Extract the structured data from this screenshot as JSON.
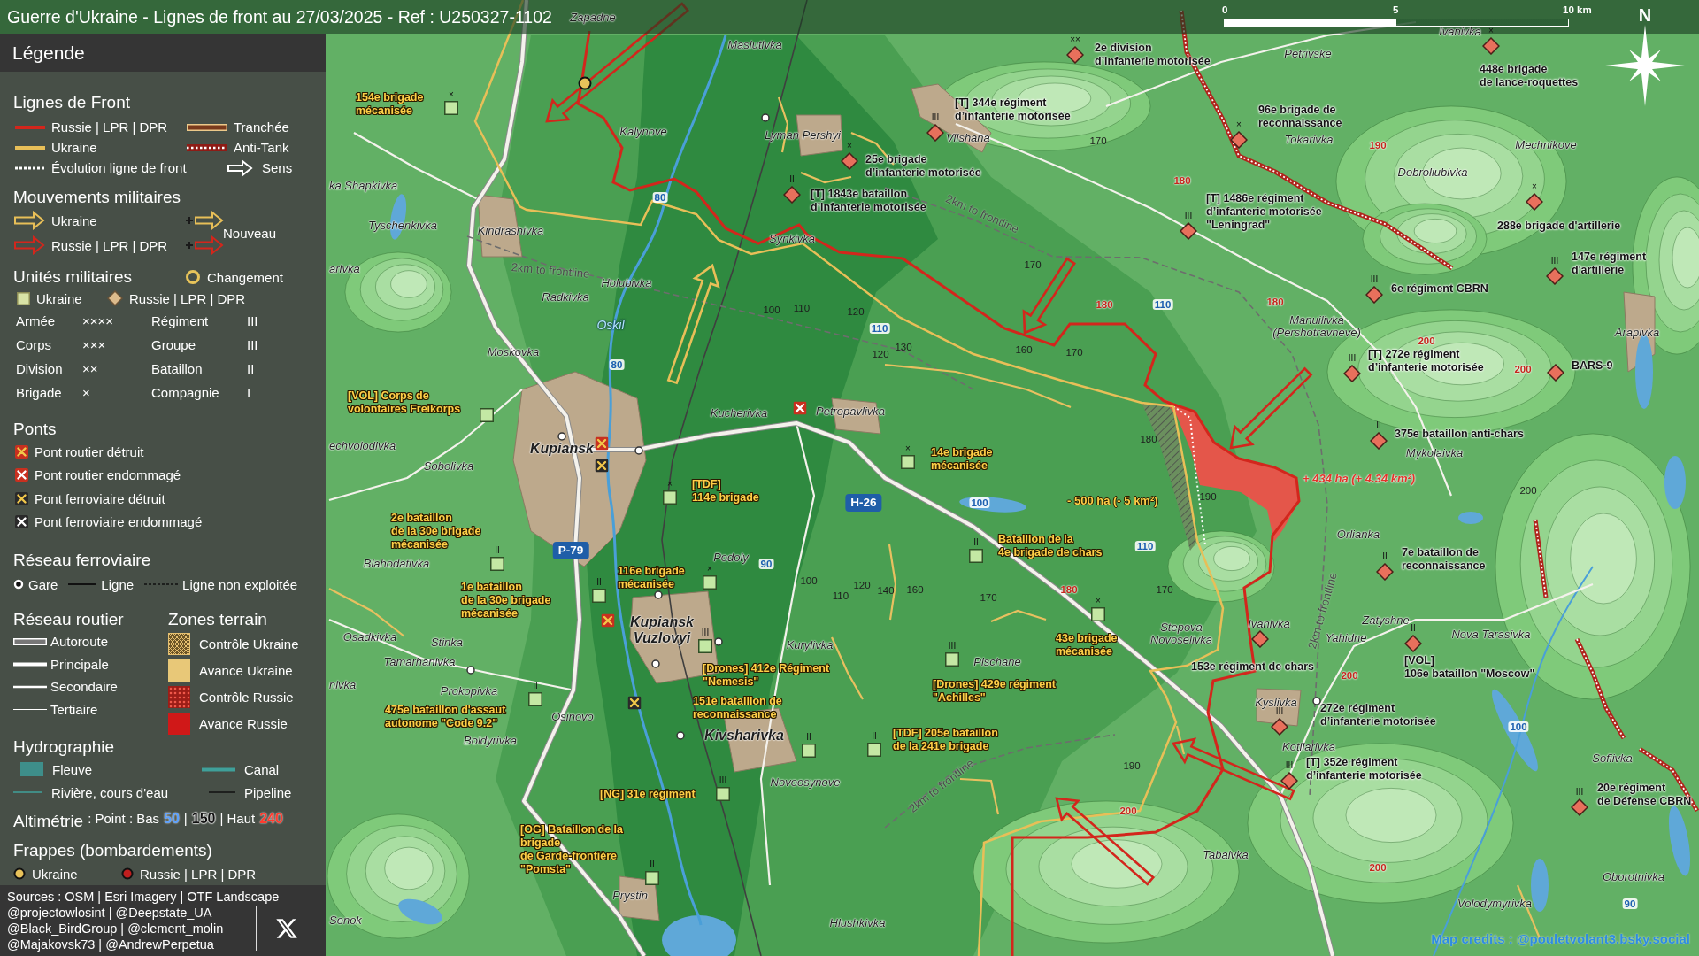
{
  "title": "Guerre d'Ukraine - Lignes de front au 27/03/2025 - Ref : U250327-1102",
  "scale": {
    "ticks": [
      "0",
      "5",
      "10 km"
    ]
  },
  "compass": "N",
  "legend": {
    "title": "Légende",
    "front_lines": {
      "heading": "Lignes de Front",
      "items": [
        {
          "label": "Russie | LPR | DPR",
          "kind": "russia-line"
        },
        {
          "label": "Tranchée",
          "kind": "trench"
        },
        {
          "label": "Ukraine",
          "kind": "ukraine-line"
        },
        {
          "label": "Anti-Tank",
          "kind": "antitank"
        },
        {
          "label": "Évolution ligne de front",
          "kind": "evolution"
        },
        {
          "label": "Sens",
          "kind": "direction"
        }
      ]
    },
    "movements": {
      "heading": "Mouvements militaires",
      "items": [
        {
          "label": "Ukraine",
          "kind": "ukraine"
        },
        {
          "label": "Russie | LPR | DPR",
          "kind": "russia"
        }
      ],
      "new_label": "Nouveau"
    },
    "units": {
      "heading": "Unités militaires",
      "change_label": "Changement",
      "markers": [
        {
          "label": "Ukraine",
          "kind": "ukraine"
        },
        {
          "label": "Russie | LPR | DPR",
          "kind": "russia"
        }
      ],
      "echelons": [
        {
          "label": "Armée",
          "symbol": "××××"
        },
        {
          "label": "Régiment",
          "symbol": "III"
        },
        {
          "label": "Corps",
          "symbol": "×××"
        },
        {
          "label": "Groupe",
          "symbol": "III"
        },
        {
          "label": "Division",
          "symbol": "××"
        },
        {
          "label": "Bataillon",
          "symbol": "II"
        },
        {
          "label": "Brigade",
          "symbol": "×"
        },
        {
          "label": "Compagnie",
          "symbol": "I"
        }
      ]
    },
    "bridges": {
      "heading": "Ponts",
      "items": [
        {
          "label": "Pont routier détruit",
          "kind": "road-destroyed"
        },
        {
          "label": "Pont routier endommagé",
          "kind": "road-damaged"
        },
        {
          "label": "Pont ferroviaire détruit",
          "kind": "rail-destroyed"
        },
        {
          "label": "Pont ferroviaire endommagé",
          "kind": "rail-damaged"
        }
      ]
    },
    "railway": {
      "heading": "Réseau ferroviaire",
      "items": [
        {
          "label": "Gare",
          "kind": "station"
        },
        {
          "label": "Ligne",
          "kind": "line"
        },
        {
          "label": "Ligne non exploitée",
          "kind": "unused"
        }
      ]
    },
    "roads": {
      "heading": "Réseau routier",
      "items": [
        {
          "label": "Autoroute",
          "kind": "motorway"
        },
        {
          "label": "Principale",
          "kind": "primary"
        },
        {
          "label": "Secondaire",
          "kind": "secondary"
        },
        {
          "label": "Tertiaire",
          "kind": "tertiary"
        }
      ]
    },
    "zones": {
      "heading": "Zones terrain",
      "items": [
        {
          "label": "Contrôle Ukraine",
          "kind": "ukraine-control"
        },
        {
          "label": "Avance Ukraine",
          "kind": "ukraine-advance"
        },
        {
          "label": "Contrôle Russie",
          "kind": "russia-control"
        },
        {
          "label": "Avance Russie",
          "kind": "russia-advance"
        }
      ]
    },
    "hydrography": {
      "heading": "Hydrographie",
      "items": [
        {
          "label": "Fleuve",
          "kind": "river"
        },
        {
          "label": "Canal",
          "kind": "canal"
        },
        {
          "label": "Rivière, cours d'eau",
          "kind": "stream"
        },
        {
          "label": "Pipeline",
          "kind": "pipeline"
        }
      ]
    },
    "altimetry": {
      "heading": "Altimétrie",
      "parts": [
        {
          "text": ": Point : Bas",
          "kind": "plain"
        },
        {
          "text": "50",
          "kind": "low"
        },
        {
          "text": "|",
          "kind": "plain"
        },
        {
          "text": "150",
          "kind": "mid"
        },
        {
          "text": "| Haut",
          "kind": "plain"
        },
        {
          "text": "240",
          "kind": "high"
        }
      ]
    },
    "strikes": {
      "heading": "Frappes (bombardements)",
      "items": [
        {
          "label": "Ukraine",
          "kind": "ukraine"
        },
        {
          "label": "Russie | LPR | DPR",
          "kind": "russia"
        }
      ]
    },
    "sources": [
      "Sources : OSM | Esri Imagery | OTF Landscape",
      "@projectowlosint | @Deepstate_UA",
      "@Black_BirdGroup | @clement_molin",
      "@Majakovsk73 | @AndrewPerpetua"
    ]
  },
  "map": {
    "places": [
      {
        "name": "Zapadne",
        "kind": "village"
      },
      {
        "name": "Ivanivka",
        "kind": "village"
      },
      {
        "name": "Masiutivka",
        "kind": "village"
      },
      {
        "name": "Petrivske",
        "kind": "village"
      },
      {
        "name": "Kalynove",
        "kind": "village"
      },
      {
        "name": "Lyman Pershyi",
        "kind": "village"
      },
      {
        "name": "Vilshana",
        "kind": "village"
      },
      {
        "name": "Tokarivka",
        "kind": "village"
      },
      {
        "name": "Mechnikove",
        "kind": "village"
      },
      {
        "name": "Dobroliubivka",
        "kind": "village"
      },
      {
        "name": "ka Shapkivka",
        "kind": "village"
      },
      {
        "name": "Tyschenkivka",
        "kind": "village"
      },
      {
        "name": "Kindrashivka",
        "kind": "village"
      },
      {
        "name": "Synkivka",
        "kind": "village"
      },
      {
        "name": "arivka",
        "kind": "village"
      },
      {
        "name": "Holubivka",
        "kind": "village"
      },
      {
        "name": "Radkivka",
        "kind": "village"
      },
      {
        "name": "Oskil",
        "kind": "river"
      },
      {
        "name": "Manuilivka\n(Pershotravneve)",
        "kind": "village"
      },
      {
        "name": "Arapivka",
        "kind": "village"
      },
      {
        "name": "Moskovka",
        "kind": "village"
      },
      {
        "name": "Kucherivka",
        "kind": "village"
      },
      {
        "name": "Petropavlivka",
        "kind": "village"
      },
      {
        "name": "echvolodivka",
        "kind": "village"
      },
      {
        "name": "Kupiansk",
        "kind": "town"
      },
      {
        "name": "Mykolaivka",
        "kind": "village"
      },
      {
        "name": "Sobolivka",
        "kind": "village"
      },
      {
        "name": "Orlianka",
        "kind": "village"
      },
      {
        "name": "Blahodativka",
        "kind": "village"
      },
      {
        "name": "Podoly",
        "kind": "village"
      },
      {
        "name": "Osadkivka",
        "kind": "village"
      },
      {
        "name": "Stinka",
        "kind": "village"
      },
      {
        "name": "Kupiansk\nVuzlovyi",
        "kind": "town"
      },
      {
        "name": "Kurylivka",
        "kind": "village"
      },
      {
        "name": "Stepova\nNovoselivka",
        "kind": "village"
      },
      {
        "name": "Ivanivka",
        "kind": "village"
      },
      {
        "name": "Yahidne",
        "kind": "village"
      },
      {
        "name": "Zatyshne",
        "kind": "village"
      },
      {
        "name": "Nova Tarasivka",
        "kind": "village"
      },
      {
        "name": "Tamarhanivka",
        "kind": "village"
      },
      {
        "name": "Pischane",
        "kind": "village"
      },
      {
        "name": "nivka",
        "kind": "village"
      },
      {
        "name": "Prokopivka",
        "kind": "village"
      },
      {
        "name": "Kyslivka",
        "kind": "village"
      },
      {
        "name": "Osinovo",
        "kind": "village"
      },
      {
        "name": "Boldyrivka",
        "kind": "village"
      },
      {
        "name": "Kivsharivka",
        "kind": "town"
      },
      {
        "name": "Kotliarivka",
        "kind": "village"
      },
      {
        "name": "Sofiivka",
        "kind": "village"
      },
      {
        "name": "Novoosynove",
        "kind": "village"
      },
      {
        "name": "Tabaivka",
        "kind": "village"
      },
      {
        "name": "Oborotnivka",
        "kind": "village"
      },
      {
        "name": "Prystin",
        "kind": "village"
      },
      {
        "name": "Volodymyrivka",
        "kind": "village"
      },
      {
        "name": "Senok",
        "kind": "village"
      },
      {
        "name": "Hlushkivka",
        "kind": "village"
      }
    ],
    "units": [
      {
        "label": "2e division\nd’infanterie motorisée",
        "kind": "russia",
        "echelon": "××"
      },
      {
        "label": "[T] 344e régiment\nd’infanterie motorisée",
        "kind": "russia",
        "echelon": "III"
      },
      {
        "label": "448e brigade\nde lance-roquettes",
        "kind": "russia",
        "echelon": "×"
      },
      {
        "label": "96e brigade de\nreconnaissance",
        "kind": "russia",
        "echelon": "×"
      },
      {
        "label": "25e brigade\nd’infanterie motorisée",
        "kind": "russia",
        "echelon": "×"
      },
      {
        "label": "[T] 1843e bataillon\nd’infanterie motorisée",
        "kind": "russia",
        "echelon": "II"
      },
      {
        "label": "[T] 1486e régiment\nd’infanterie motorisée\n\"Leningrad\"",
        "kind": "russia",
        "echelon": "III"
      },
      {
        "label": "288e brigade d'artillerie",
        "kind": "russia",
        "echelon": "×"
      },
      {
        "label": "147e régiment\nd'artillerie",
        "kind": "russia",
        "echelon": "III"
      },
      {
        "label": "6e régiment CBRN",
        "kind": "russia",
        "echelon": "III"
      },
      {
        "label": "[T] 272e régiment\nd’infanterie motorisée",
        "kind": "russia",
        "echelon": "III"
      },
      {
        "label": "BARS-9",
        "kind": "russia"
      },
      {
        "label": "375e bataillon anti-chars",
        "kind": "russia",
        "echelon": "II"
      },
      {
        "label": "7e bataillon de\nreconnaissance",
        "kind": "russia",
        "echelon": "II"
      },
      {
        "label": "153e régiment de chars",
        "kind": "russia"
      },
      {
        "label": "[VOL]\n106e bataillon \"Moscow\"",
        "kind": "russia",
        "echelon": "II"
      },
      {
        "label": "272e régiment\nd’infanterie motorisée",
        "kind": "russia",
        "echelon": "III"
      },
      {
        "label": "[T] 352e régiment\nd’infanterie motorisée",
        "kind": "russia",
        "echelon": "III"
      },
      {
        "label": "20e régiment\nde Défense CBRN",
        "kind": "russia",
        "echelon": "III"
      },
      {
        "label": "154e brigade\nmécanisée",
        "kind": "ukraine",
        "echelon": "×"
      },
      {
        "label": "[VOL] Corps de\nvolontaires Freikorps",
        "kind": "ukraine"
      },
      {
        "label": "[TDF]\n114e brigade",
        "kind": "ukraine",
        "echelon": "×"
      },
      {
        "label": "14e brigade\nmécanisée",
        "kind": "ukraine",
        "echelon": "×"
      },
      {
        "label": "2e bataillon\nde la 30e brigade\nmécanisée",
        "kind": "ukraine",
        "echelon": "II"
      },
      {
        "label": "1e bataillon\nde la 30e brigade\nmécanisée",
        "kind": "ukraine",
        "echelon": "II"
      },
      {
        "label": "116e brigade\nmécanisée",
        "kind": "ukraine",
        "echelon": "×"
      },
      {
        "label": "Bataillon de la\n4e brigade de chars",
        "kind": "ukraine",
        "echelon": "II"
      },
      {
        "label": "43e brigade\nmécanisée",
        "kind": "ukraine",
        "echelon": "×"
      },
      {
        "label": "[Drones] 412e Régiment\n\"Nemesis\"",
        "kind": "ukraine",
        "echelon": "III"
      },
      {
        "label": "[Drones] 429e régiment\n\"Achilles\"",
        "kind": "ukraine",
        "echelon": "III"
      },
      {
        "label": "475e bataillon d'assaut\nautonome \"Code 9.2\"",
        "kind": "ukraine",
        "echelon": "II"
      },
      {
        "label": "151e bataillon de\nreconnaissance",
        "kind": "ukraine",
        "echelon": "II"
      },
      {
        "label": "[TDF] 205e bataillon\nde la 241e brigade",
        "kind": "ukraine",
        "echelon": "II"
      },
      {
        "label": "[NG] 31e régiment",
        "kind": "ukraine",
        "echelon": "III"
      },
      {
        "label": "[OG] Bataillon de la\nbrigade\nde Garde-frontière\n\"Pomsta\"",
        "kind": "ukraine",
        "echelon": "II"
      }
    ],
    "elevation_points": [
      {
        "value": "170",
        "kind": "mid"
      },
      {
        "value": "190",
        "kind": "high"
      },
      {
        "value": "180",
        "kind": "high"
      },
      {
        "value": "80",
        "kind": "low"
      },
      {
        "value": "170",
        "kind": "mid"
      },
      {
        "value": "100",
        "kind": "mid"
      },
      {
        "value": "110",
        "kind": "mid"
      },
      {
        "value": "120",
        "kind": "mid"
      },
      {
        "value": "180",
        "kind": "high"
      },
      {
        "value": "110",
        "kind": "low"
      },
      {
        "value": "180",
        "kind": "high"
      },
      {
        "value": "110",
        "kind": "low"
      },
      {
        "value": "120",
        "kind": "mid"
      },
      {
        "value": "130",
        "kind": "mid"
      },
      {
        "value": "160",
        "kind": "mid"
      },
      {
        "value": "170",
        "kind": "mid"
      },
      {
        "value": "200",
        "kind": "high"
      },
      {
        "value": "80",
        "kind": "low"
      },
      {
        "value": "200",
        "kind": "high"
      },
      {
        "value": "180",
        "kind": "mid"
      },
      {
        "value": "100",
        "kind": "low"
      },
      {
        "value": "190",
        "kind": "mid"
      },
      {
        "value": "200",
        "kind": "mid"
      },
      {
        "value": "110",
        "kind": "low"
      },
      {
        "value": "90",
        "kind": "low"
      },
      {
        "value": "100",
        "kind": "mid"
      },
      {
        "value": "110",
        "kind": "mid"
      },
      {
        "value": "120",
        "kind": "mid"
      },
      {
        "value": "140",
        "kind": "mid"
      },
      {
        "value": "160",
        "kind": "mid"
      },
      {
        "value": "170",
        "kind": "mid"
      },
      {
        "value": "180",
        "kind": "high"
      },
      {
        "value": "170",
        "kind": "mid"
      },
      {
        "value": "200",
        "kind": "high"
      },
      {
        "value": "100",
        "kind": "low"
      },
      {
        "value": "190",
        "kind": "mid"
      },
      {
        "value": "200",
        "kind": "high"
      },
      {
        "value": "200",
        "kind": "high"
      },
      {
        "value": "90",
        "kind": "low"
      }
    ],
    "distance_labels": [
      "2km to frontline",
      "2km to frontline",
      "2km to frontline",
      "2km to frontline"
    ],
    "road_numbers": [
      "P-79",
      "H-26"
    ],
    "area_changes": [
      {
        "text": "+ 434 ha (+ 4.34 km²)",
        "kind": "russia"
      },
      {
        "text": "- 500 ha (- 5 km²)",
        "kind": "ukraine"
      }
    ],
    "bridges": [
      {
        "kind": "road-destroyed"
      },
      {
        "kind": "rail-destroyed"
      },
      {
        "kind": "road-damaged"
      },
      {
        "kind": "road-destroyed"
      },
      {
        "kind": "rail-destroyed"
      }
    ],
    "strikes": [
      {
        "kind": "ukraine"
      }
    ],
    "credits": "Map credits : @pouletvolant3.bsky.social"
  }
}
